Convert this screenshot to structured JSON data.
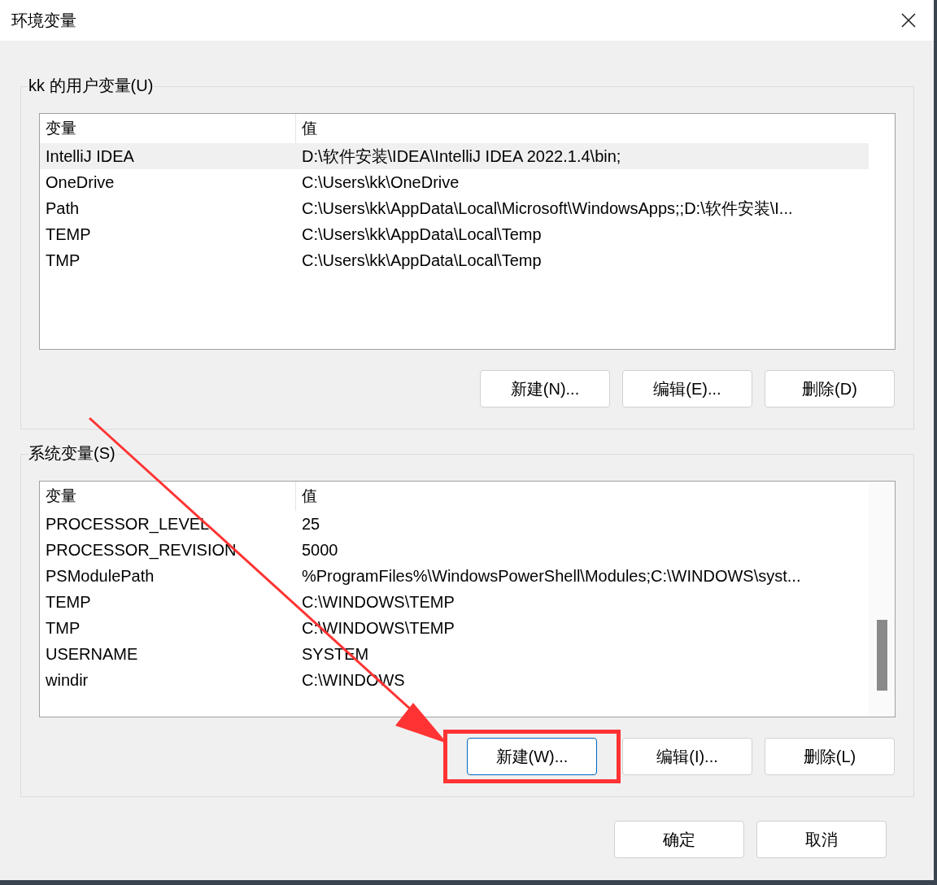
{
  "window": {
    "title": "环境变量"
  },
  "user_vars": {
    "legend": "kk 的用户变量(U)",
    "columns": [
      "变量",
      "值"
    ],
    "rows": [
      {
        "name": "IntelliJ IDEA",
        "value": "D:\\软件安装\\IDEA\\IntelliJ IDEA 2022.1.4\\bin;",
        "selected": true
      },
      {
        "name": "OneDrive",
        "value": "C:\\Users\\kk\\OneDrive",
        "selected": false
      },
      {
        "name": "Path",
        "value": "C:\\Users\\kk\\AppData\\Local\\Microsoft\\WindowsApps;;D:\\软件安装\\I...",
        "selected": false
      },
      {
        "name": "TEMP",
        "value": "C:\\Users\\kk\\AppData\\Local\\Temp",
        "selected": false
      },
      {
        "name": "TMP",
        "value": "C:\\Users\\kk\\AppData\\Local\\Temp",
        "selected": false
      }
    ],
    "buttons": [
      {
        "label": "新建(N)...",
        "focused": false,
        "highlighted": false
      },
      {
        "label": "编辑(E)...",
        "focused": false,
        "highlighted": false
      },
      {
        "label": "删除(D)",
        "focused": false,
        "highlighted": false
      }
    ]
  },
  "system_vars": {
    "legend": "系统变量(S)",
    "columns": [
      "变量",
      "值"
    ],
    "rows": [
      {
        "name": "PROCESSOR_LEVEL",
        "value": "25",
        "selected": false
      },
      {
        "name": "PROCESSOR_REVISION",
        "value": "5000",
        "selected": false
      },
      {
        "name": "PSModulePath",
        "value": "%ProgramFiles%\\WindowsPowerShell\\Modules;C:\\WINDOWS\\syst...",
        "selected": false
      },
      {
        "name": "TEMP",
        "value": "C:\\WINDOWS\\TEMP",
        "selected": false
      },
      {
        "name": "TMP",
        "value": "C:\\WINDOWS\\TEMP",
        "selected": false
      },
      {
        "name": "USERNAME",
        "value": "SYSTEM",
        "selected": false
      },
      {
        "name": "windir",
        "value": "C:\\WINDOWS",
        "selected": false
      }
    ],
    "buttons": [
      {
        "label": "新建(W)...",
        "focused": true,
        "highlighted": true
      },
      {
        "label": "编辑(I)...",
        "focused": false,
        "highlighted": false
      },
      {
        "label": "删除(L)",
        "focused": false,
        "highlighted": false
      }
    ]
  },
  "footer_buttons": [
    "确定",
    "取消"
  ]
}
